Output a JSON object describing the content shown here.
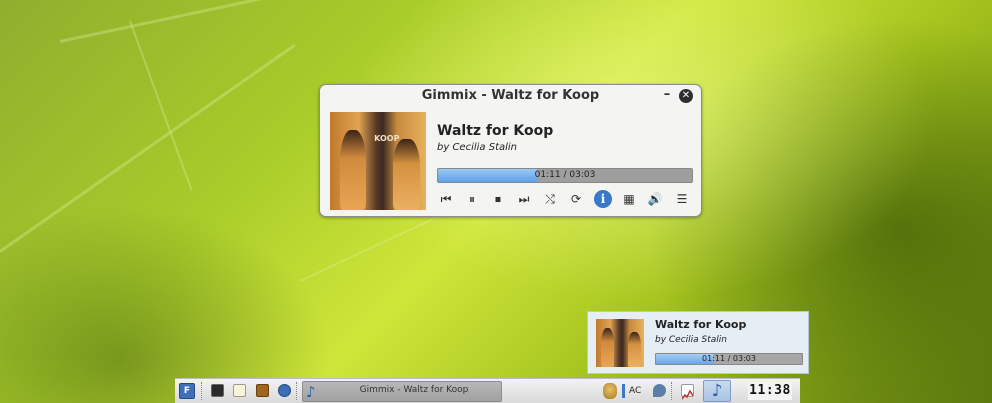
{
  "window": {
    "title": "Gimmix - Waltz for Koop",
    "minimize_glyph": "–",
    "close_glyph": "✕"
  },
  "player": {
    "cover_text": "KOOP",
    "song_title": "Waltz for Koop",
    "artist": "by Cecilia Stalin",
    "progress_label": "01:11 / 03:03",
    "progress_fraction": 0.388,
    "controls": [
      {
        "name": "previous-icon",
        "glyph": "⏮"
      },
      {
        "name": "pause-icon",
        "glyph": "⏸"
      },
      {
        "name": "stop-icon",
        "glyph": "⏹"
      },
      {
        "name": "next-icon",
        "glyph": "⏭"
      },
      {
        "name": "shuffle-icon",
        "glyph": "⤭"
      },
      {
        "name": "repeat-icon",
        "glyph": "⟳"
      },
      {
        "name": "info-icon",
        "glyph": "i"
      },
      {
        "name": "preferences-icon",
        "glyph": "▦"
      },
      {
        "name": "volume-icon",
        "glyph": "🔊"
      },
      {
        "name": "playlist-icon",
        "glyph": "☰"
      }
    ]
  },
  "notification": {
    "song_title": "Waltz for Koop",
    "artist": "by Cecilia Stalin",
    "progress_label": "01:11 / 03:03",
    "progress_fraction": 0.388
  },
  "taskbar": {
    "task_label": "Gimmix - Waltz for Koop",
    "tray_ac_label": "AC",
    "clock": "11:38"
  },
  "colors": {
    "progress_fill": "#5ea0e8",
    "info_button": "#3a78c8"
  }
}
